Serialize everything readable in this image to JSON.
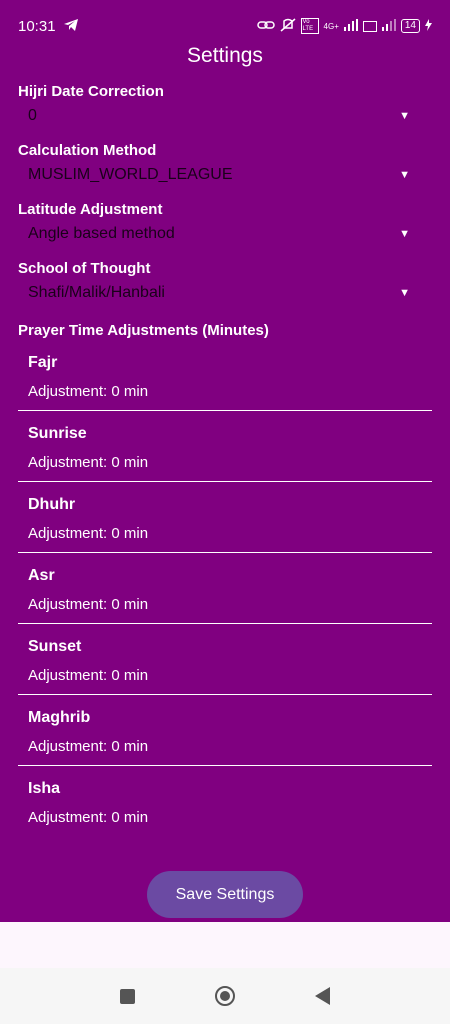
{
  "status_bar": {
    "time": "10:31",
    "battery": "14",
    "icons": [
      "telegram-icon",
      "link-icon",
      "mute-icon",
      "volte-icon",
      "signal-4g-icon",
      "volte-icon",
      "signal-icon",
      "battery-icon",
      "charging-icon"
    ],
    "network_label": "4G+",
    "volte_label": "Vo LTE"
  },
  "header": {
    "title": "Settings"
  },
  "hijri": {
    "label": "Hijri Date Correction",
    "value": "0"
  },
  "calculation": {
    "label": "Calculation Method",
    "value": "MUSLIM_WORLD_LEAGUE"
  },
  "latitude": {
    "label": "Latitude Adjustment",
    "value": "Angle based method"
  },
  "school": {
    "label": "School of Thought",
    "value": "Shafi/Malik/Hanbali"
  },
  "adjustments": {
    "label": "Prayer Time Adjustments (Minutes)",
    "items": [
      {
        "name": "Fajr",
        "adjustment": "Adjustment: 0 min"
      },
      {
        "name": "Sunrise",
        "adjustment": "Adjustment: 0 min"
      },
      {
        "name": "Dhuhr",
        "adjustment": "Adjustment: 0 min"
      },
      {
        "name": "Asr",
        "adjustment": "Adjustment: 0 min"
      },
      {
        "name": "Sunset",
        "adjustment": "Adjustment: 0 min"
      },
      {
        "name": "Maghrib",
        "adjustment": "Adjustment: 0 min"
      },
      {
        "name": "Isha",
        "adjustment": "Adjustment: 0 min"
      }
    ]
  },
  "save_button": {
    "label": "Save Settings"
  },
  "colors": {
    "background": "#800080",
    "button": "#6b4aa3",
    "dropdown_text": "#1a001a"
  }
}
